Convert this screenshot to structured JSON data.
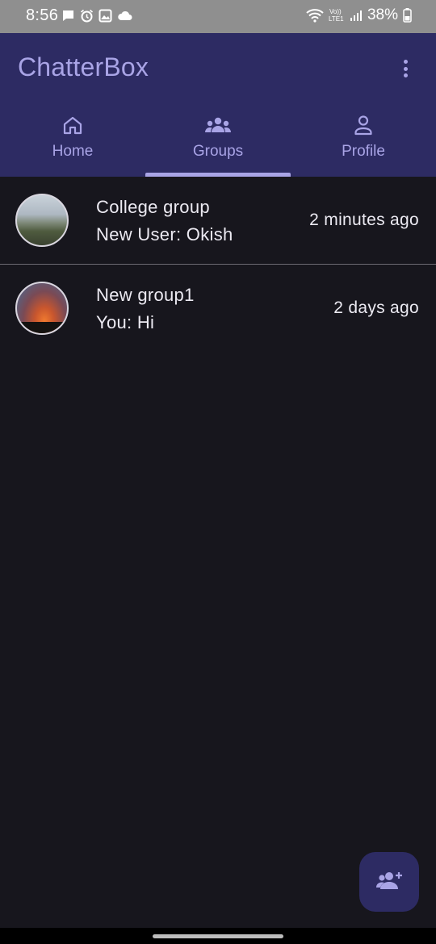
{
  "status_bar": {
    "time": "8:56",
    "left_icons": [
      "message-icon",
      "alarm-icon",
      "gallery-icon",
      "cloud-icon"
    ],
    "network_label": "Vo)) LTE1",
    "battery": "38%"
  },
  "app_bar": {
    "title": "ChatterBox",
    "menu_icon": "more-vert-icon"
  },
  "tabs": [
    {
      "label": "Home",
      "icon": "home-icon",
      "selected": false
    },
    {
      "label": "Groups",
      "icon": "groups-icon",
      "selected": true
    },
    {
      "label": "Profile",
      "icon": "person-icon",
      "selected": false
    }
  ],
  "groups": [
    {
      "name": "College group",
      "last_message": "New User: Okish",
      "time": "2 minutes ago"
    },
    {
      "name": "New group1",
      "last_message": "You: Hi",
      "time": "2 days ago"
    }
  ],
  "fab": {
    "icon": "group-add-icon"
  },
  "colors": {
    "app_bar": "#2d2b63",
    "accent": "#a9a4e6",
    "background": "#17161d",
    "text": "#eceaf2"
  }
}
